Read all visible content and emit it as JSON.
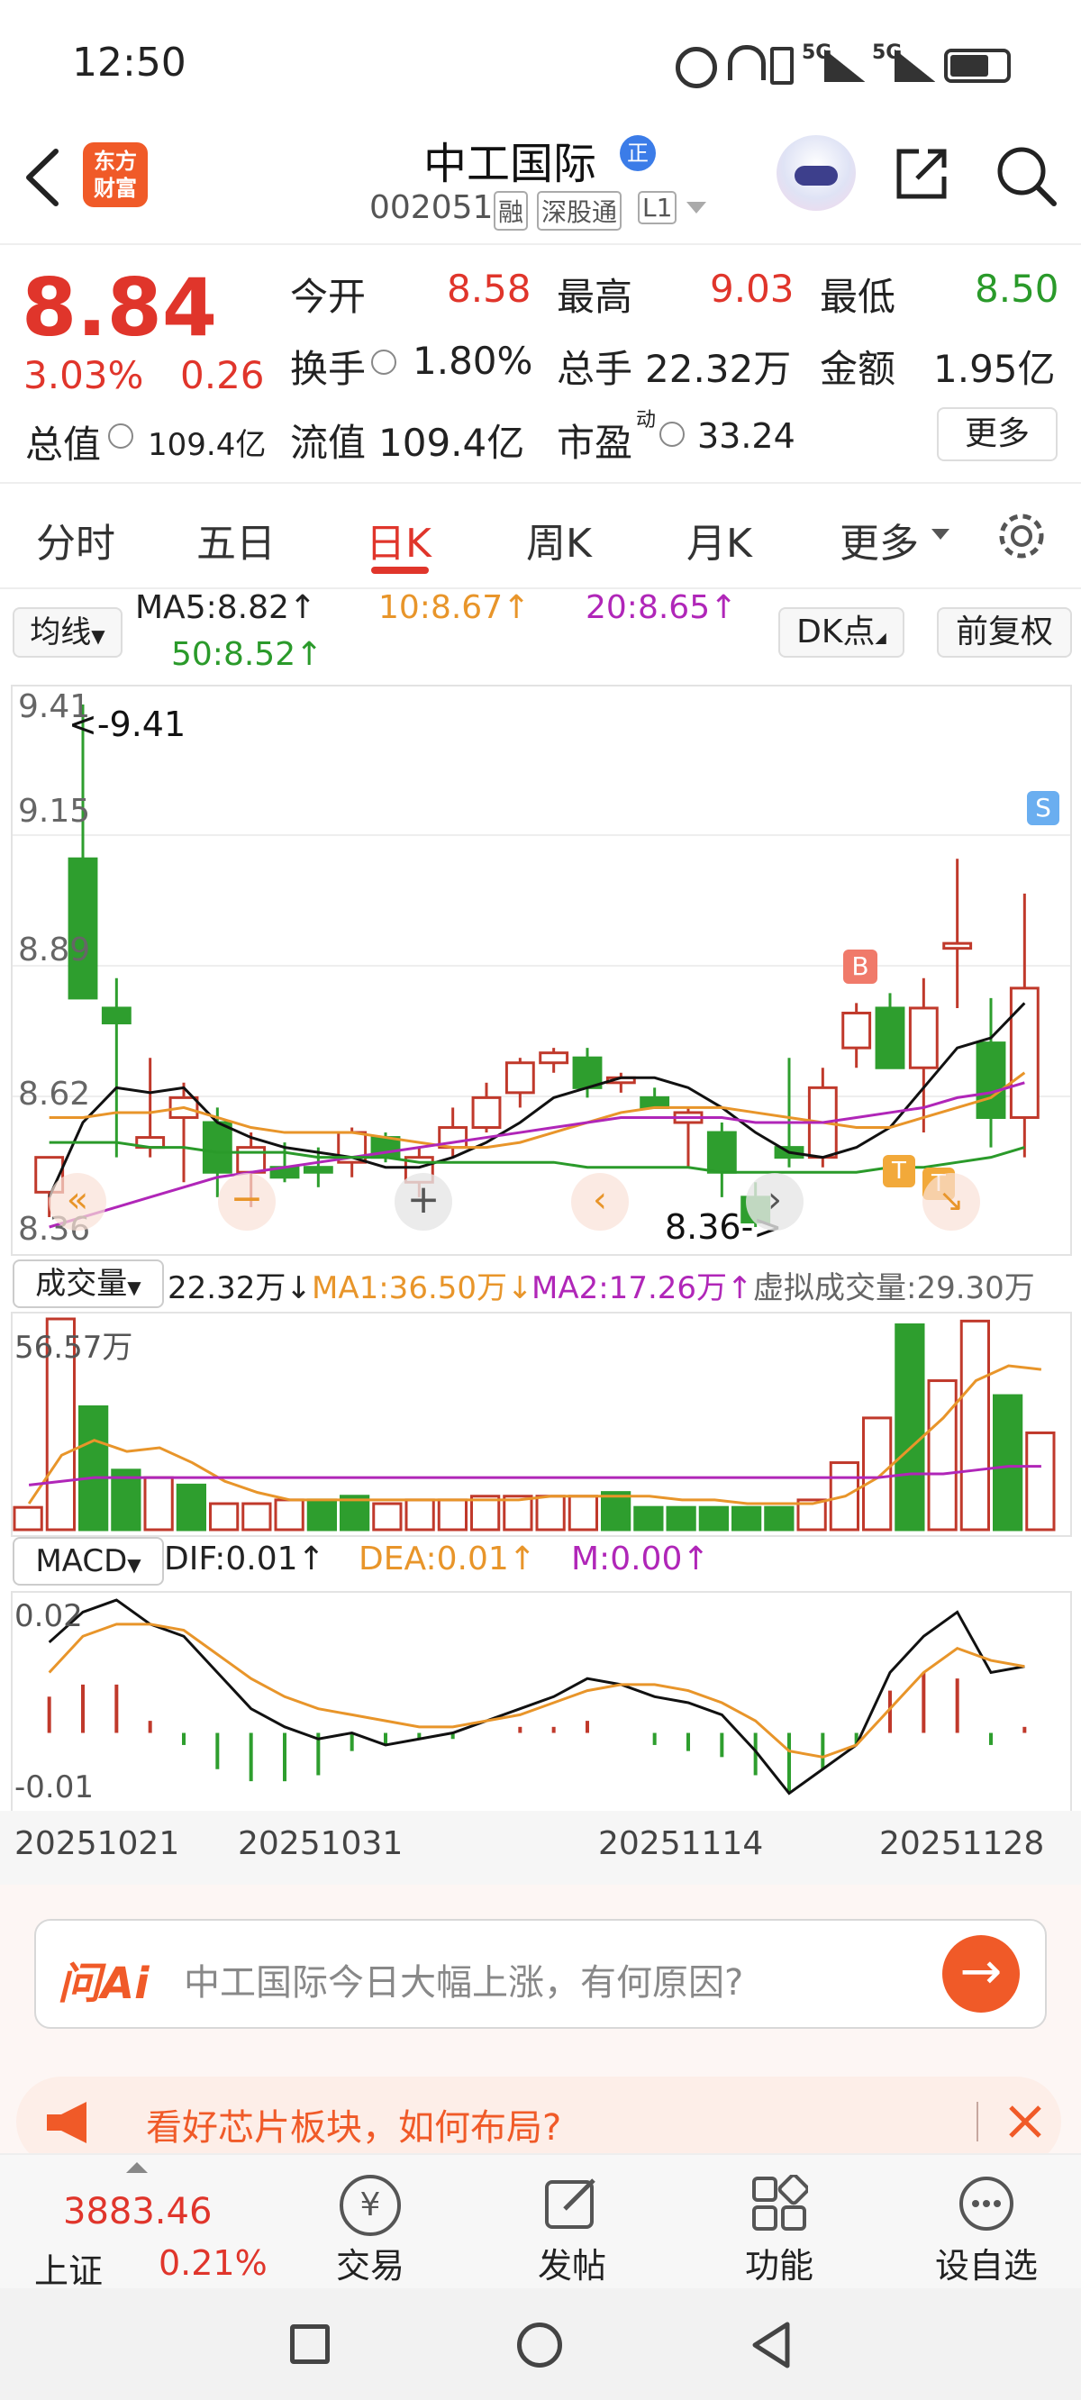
{
  "status": {
    "time": "12:50",
    "signal1": "5G",
    "signal2": "5G"
  },
  "header": {
    "logo": [
      "东方",
      "财富"
    ],
    "name": "中工国际",
    "badge": "正",
    "code": "002051",
    "tags": [
      "融",
      "深股通",
      "L1"
    ]
  },
  "quote": {
    "price": "8.84",
    "change_pct": "3.03%",
    "change": "0.26",
    "open_label": "今开",
    "open": "8.58",
    "high_label": "最高",
    "high": "9.03",
    "low_label": "最低",
    "low": "8.50",
    "turnover_label": "换手",
    "turnover": "1.80%",
    "volume_label": "总手",
    "volume": "22.32万",
    "amount_label": "金额",
    "amount": "1.95亿",
    "mktcap_label": "总值",
    "mktcap": "109.4亿",
    "float_label": "流值",
    "float": "109.4亿",
    "pe_label": "市盈",
    "pe_sup": "动",
    "pe": "33.24",
    "more": "更多"
  },
  "tabs": [
    "分时",
    "五日",
    "日K",
    "周K",
    "月K",
    "更多"
  ],
  "active_tab": "日K",
  "ma_bar": {
    "selector": "均线",
    "ma5": "MA5:8.82↑",
    "ma10": "10:8.67↑",
    "ma20": "20:8.65↑",
    "ma50": "50:8.52↑",
    "dk": "DK点",
    "adjust": "前复权"
  },
  "kline": {
    "y_labels": [
      "9.41",
      "9.15",
      "8.89",
      "8.62",
      "8.36"
    ],
    "max_label": "<-9.41",
    "min_label": "8.36->",
    "marker_b": "B",
    "marker_s": "S",
    "marker_t": "T"
  },
  "volume_bar": {
    "selector": "成交量",
    "vol": "22.32万↓",
    "ma1": "MA1:36.50万↓",
    "ma2": "MA2:17.26万↑",
    "virtual": "虚拟成交量:29.30万",
    "axis_max": "56.57万"
  },
  "macd_bar": {
    "selector": "MACD",
    "dif": "DIF:0.01↑",
    "dea": "DEA:0.01↑",
    "m": "M:0.00↑",
    "axis_top": "0.02",
    "axis_bottom": "-0.01"
  },
  "dates": [
    "20251021",
    "20251031",
    "20251114",
    "20251128"
  ],
  "ask": {
    "brand": "问Ai",
    "text": "中工国际今日大幅上涨，有何原因?"
  },
  "promo": {
    "text": "看好芯片板块，如何布局?"
  },
  "bottom": {
    "index_value": "3883.46",
    "index_name": "上证",
    "index_change": "0.21%",
    "nav": [
      "交易",
      "发帖",
      "功能",
      "设自选"
    ]
  },
  "chart_data": {
    "type": "candlestick",
    "ylim": [
      8.36,
      9.41
    ],
    "date_labels": [
      "20251021",
      "20251031",
      "20251114",
      "20251128"
    ],
    "candles": [
      {
        "o": 8.43,
        "h": 8.5,
        "l": 8.38,
        "c": 8.5
      },
      {
        "o": 9.1,
        "h": 9.41,
        "l": 8.82,
        "c": 8.82
      },
      {
        "o": 8.8,
        "h": 8.86,
        "l": 8.5,
        "c": 8.77
      },
      {
        "o": 8.52,
        "h": 8.7,
        "l": 8.5,
        "c": 8.54
      },
      {
        "o": 8.58,
        "h": 8.65,
        "l": 8.45,
        "c": 8.62
      },
      {
        "o": 8.57,
        "h": 8.6,
        "l": 8.42,
        "c": 8.47
      },
      {
        "o": 8.47,
        "h": 8.55,
        "l": 8.4,
        "c": 8.52
      },
      {
        "o": 8.48,
        "h": 8.53,
        "l": 8.45,
        "c": 8.46
      },
      {
        "o": 8.48,
        "h": 8.52,
        "l": 8.44,
        "c": 8.47
      },
      {
        "o": 8.49,
        "h": 8.56,
        "l": 8.46,
        "c": 8.55
      },
      {
        "o": 8.54,
        "h": 8.55,
        "l": 8.49,
        "c": 8.5
      },
      {
        "o": 8.45,
        "h": 8.52,
        "l": 8.42,
        "c": 8.5
      },
      {
        "o": 8.52,
        "h": 8.6,
        "l": 8.5,
        "c": 8.56
      },
      {
        "o": 8.56,
        "h": 8.65,
        "l": 8.55,
        "c": 8.62
      },
      {
        "o": 8.63,
        "h": 8.7,
        "l": 8.6,
        "c": 8.69
      },
      {
        "o": 8.69,
        "h": 8.72,
        "l": 8.67,
        "c": 8.71
      },
      {
        "o": 8.7,
        "h": 8.72,
        "l": 8.62,
        "c": 8.64
      },
      {
        "o": 8.65,
        "h": 8.67,
        "l": 8.63,
        "c": 8.66
      },
      {
        "o": 8.62,
        "h": 8.64,
        "l": 8.6,
        "c": 8.6
      },
      {
        "o": 8.57,
        "h": 8.6,
        "l": 8.48,
        "c": 8.59
      },
      {
        "o": 8.55,
        "h": 8.57,
        "l": 8.42,
        "c": 8.47
      },
      {
        "o": 8.42,
        "h": 8.45,
        "l": 8.36,
        "c": 8.37
      },
      {
        "o": 8.52,
        "h": 8.7,
        "l": 8.48,
        "c": 8.5
      },
      {
        "o": 8.5,
        "h": 8.68,
        "l": 8.48,
        "c": 8.64
      },
      {
        "o": 8.72,
        "h": 8.81,
        "l": 8.68,
        "c": 8.79
      },
      {
        "o": 8.8,
        "h": 8.83,
        "l": 8.7,
        "c": 8.68
      },
      {
        "o": 8.68,
        "h": 8.86,
        "l": 8.55,
        "c": 8.8
      },
      {
        "o": 8.92,
        "h": 9.1,
        "l": 8.8,
        "c": 8.93
      },
      {
        "o": 8.73,
        "h": 8.82,
        "l": 8.52,
        "c": 8.58
      },
      {
        "o": 8.58,
        "h": 9.03,
        "l": 8.5,
        "c": 8.84
      }
    ],
    "ma": [
      {
        "name": "MA5",
        "color": "#111111",
        "values": [
          8.42,
          8.57,
          8.64,
          8.63,
          8.64,
          8.57,
          8.54,
          8.52,
          8.51,
          8.5,
          8.48,
          8.48,
          8.5,
          8.53,
          8.57,
          8.62,
          8.64,
          8.66,
          8.66,
          8.64,
          8.6,
          8.55,
          8.51,
          8.5,
          8.52,
          8.56,
          8.64,
          8.72,
          8.74,
          8.81
        ]
      },
      {
        "name": "MA10",
        "color": "#e8952a",
        "values": [
          8.58,
          8.58,
          8.59,
          8.59,
          8.6,
          8.58,
          8.56,
          8.55,
          8.55,
          8.55,
          8.54,
          8.53,
          8.52,
          8.52,
          8.53,
          8.55,
          8.57,
          8.59,
          8.6,
          8.6,
          8.6,
          8.59,
          8.58,
          8.57,
          8.56,
          8.56,
          8.58,
          8.6,
          8.62,
          8.67
        ]
      },
      {
        "name": "MA20",
        "color": "#b026b8",
        "values": [
          8.36,
          8.38,
          8.4,
          8.42,
          8.44,
          8.46,
          8.47,
          8.48,
          8.49,
          8.5,
          8.51,
          8.52,
          8.53,
          8.54,
          8.55,
          8.56,
          8.57,
          8.58,
          8.58,
          8.58,
          8.58,
          8.57,
          8.57,
          8.57,
          8.58,
          8.59,
          8.6,
          8.62,
          8.63,
          8.65
        ]
      },
      {
        "name": "MA50",
        "color": "#2a9a2a",
        "values": [
          8.53,
          8.53,
          8.53,
          8.52,
          8.52,
          8.51,
          8.51,
          8.51,
          8.5,
          8.5,
          8.5,
          8.49,
          8.49,
          8.49,
          8.49,
          8.49,
          8.48,
          8.48,
          8.48,
          8.48,
          8.47,
          8.47,
          8.47,
          8.47,
          8.47,
          8.48,
          8.48,
          8.49,
          8.5,
          8.52
        ]
      }
    ],
    "volume": {
      "ylim": [
        0,
        56.57
      ],
      "values": [
        6,
        56.57,
        33,
        16,
        14,
        12,
        7,
        7,
        8,
        8,
        9,
        7,
        8,
        8,
        9,
        9,
        9,
        9,
        10,
        6,
        6,
        6,
        6,
        6,
        8,
        18,
        30,
        55,
        40,
        56,
        36,
        26
      ],
      "ma1": [
        7,
        20,
        24,
        21,
        22,
        18,
        13,
        10,
        8,
        8,
        8,
        8,
        8,
        8,
        8,
        8,
        9,
        9,
        9,
        9,
        8,
        8,
        7,
        7,
        7,
        9,
        14,
        22,
        30,
        40,
        44,
        43
      ],
      "ma2": [
        12,
        13,
        14,
        14,
        14,
        14,
        14,
        14,
        14,
        14,
        14,
        14,
        14,
        14,
        14,
        14,
        14,
        14,
        14,
        14,
        14,
        14,
        14,
        14,
        14,
        14,
        14,
        15,
        15,
        16,
        17,
        17
      ]
    },
    "macd": {
      "ylim": [
        -0.012,
        0.022
      ],
      "dif": [
        0.015,
        0.02,
        0.022,
        0.018,
        0.016,
        0.01,
        0.004,
        0.001,
        -0.001,
        0.0,
        -0.002,
        -0.001,
        0.0,
        0.002,
        0.004,
        0.006,
        0.009,
        0.008,
        0.006,
        0.005,
        0.003,
        -0.003,
        -0.01,
        -0.006,
        -0.002,
        0.01,
        0.016,
        0.02,
        0.01,
        0.011
      ],
      "dea": [
        0.01,
        0.016,
        0.018,
        0.018,
        0.017,
        0.013,
        0.009,
        0.006,
        0.004,
        0.003,
        0.002,
        0.001,
        0.001,
        0.002,
        0.003,
        0.005,
        0.007,
        0.008,
        0.008,
        0.007,
        0.005,
        0.002,
        -0.003,
        -0.004,
        -0.002,
        0.004,
        0.01,
        0.014,
        0.012,
        0.011
      ],
      "hist": [
        0.006,
        0.008,
        0.008,
        0.002,
        -0.002,
        -0.006,
        -0.008,
        -0.008,
        -0.007,
        -0.003,
        -0.002,
        -0.001,
        -0.001,
        0.0,
        0.001,
        0.001,
        0.002,
        0.0,
        -0.002,
        -0.003,
        -0.004,
        -0.007,
        -0.01,
        -0.006,
        -0.002,
        0.007,
        0.01,
        0.009,
        -0.002,
        0.001
      ]
    }
  }
}
